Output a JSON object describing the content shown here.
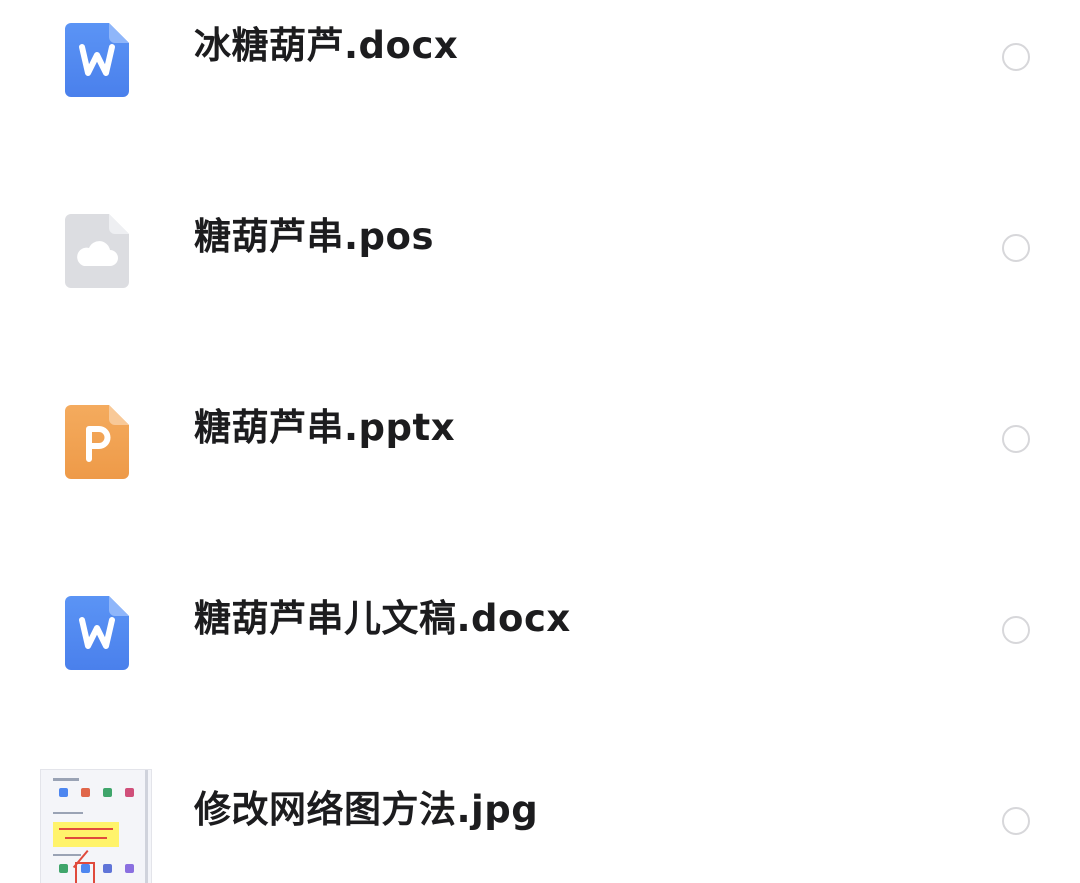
{
  "files": [
    {
      "name": "冰糖葫芦.docx",
      "icon": "word-doc-icon",
      "selected": false
    },
    {
      "name": "糖葫芦串.pos",
      "icon": "cloud-file-icon",
      "selected": false
    },
    {
      "name": "糖葫芦串.pptx",
      "icon": "powerpoint-icon",
      "selected": false
    },
    {
      "name": "糖葫芦串儿文稿.docx",
      "icon": "word-doc-icon",
      "selected": false
    },
    {
      "name": "修改网络图方法.jpg",
      "icon": "image-thumbnail",
      "selected": false
    }
  ],
  "colors": {
    "word": "#4d86f0",
    "powerpoint": "#f0a050",
    "cloud_file": "#d9dade",
    "radio_border": "#d7d7da",
    "text": "#1c1c1e"
  }
}
